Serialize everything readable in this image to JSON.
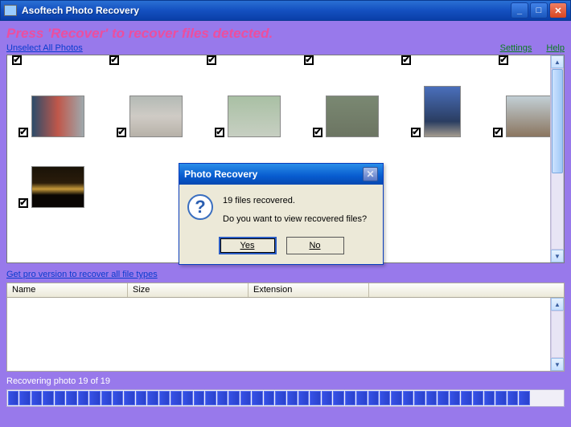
{
  "window": {
    "title": "Asoftech Photo Recovery"
  },
  "banner": "Press 'Recover' to recover files detected.",
  "links": {
    "unselect": "Unselect All Photos",
    "settings": "Settings",
    "help": "Help",
    "pro": "Get pro version to recover all file types"
  },
  "table": {
    "col1": "Name",
    "col2": "Size",
    "col3": "Extension"
  },
  "status": "Recovering photo 19 of 19",
  "dialog": {
    "title": "Photo Recovery",
    "line1": "19 files recovered.",
    "line2": "Do you want to view recovered files?",
    "yes": "Yes",
    "no": "No"
  }
}
